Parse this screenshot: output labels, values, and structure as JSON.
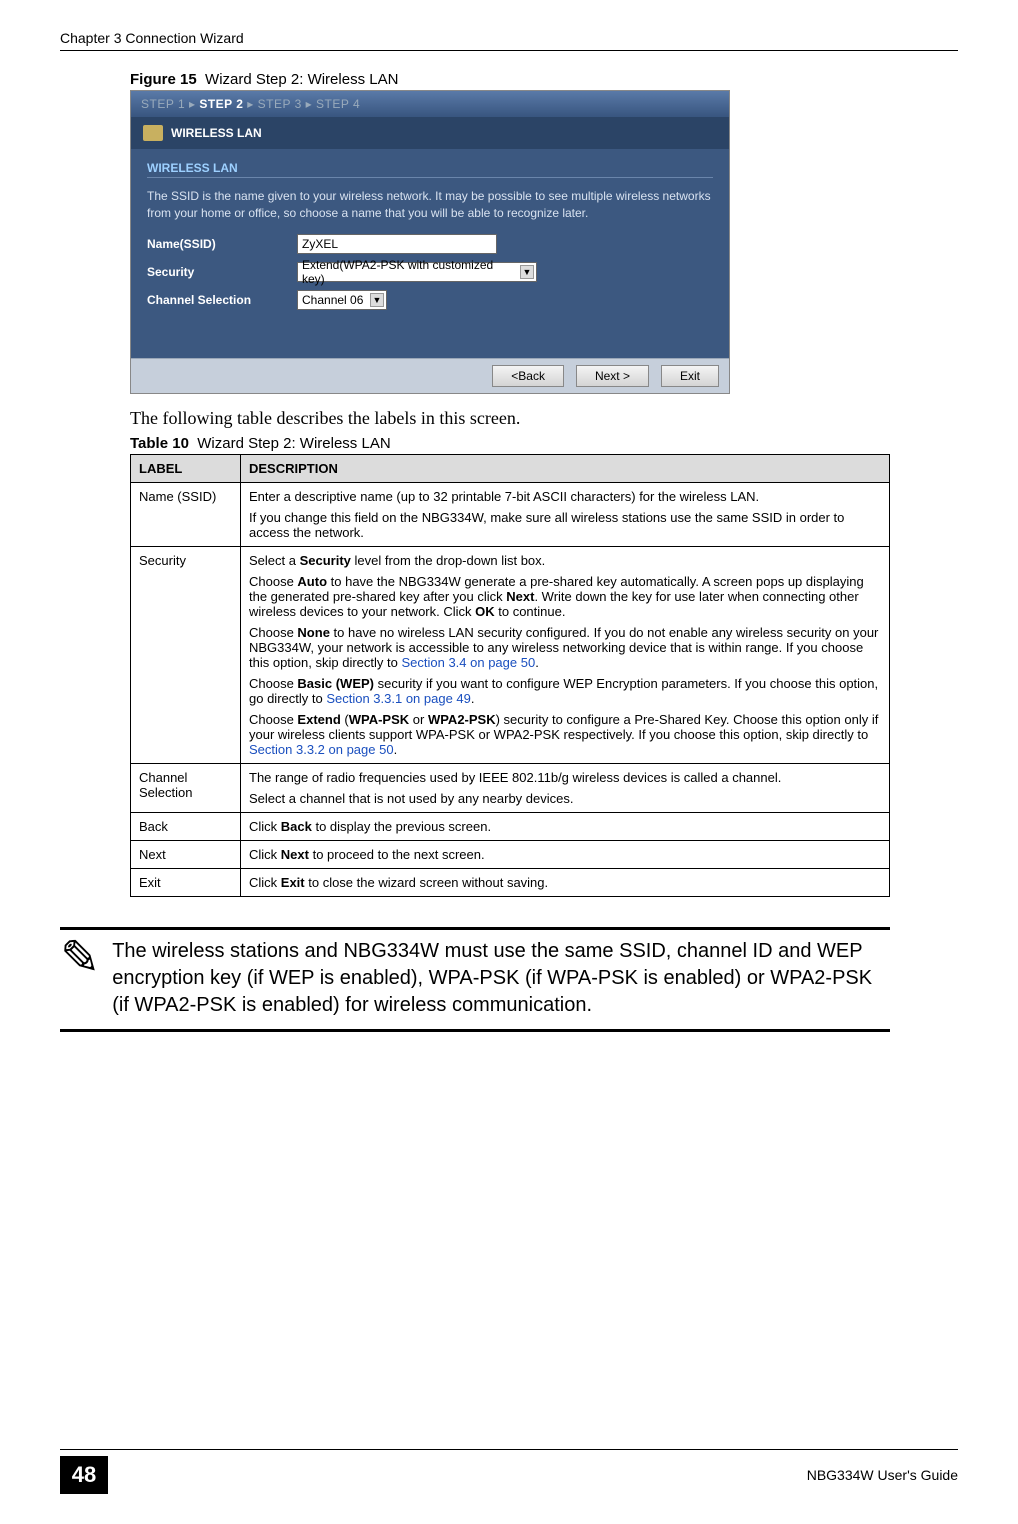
{
  "header": {
    "chapter": "Chapter 3 Connection Wizard"
  },
  "figure": {
    "label": "Figure 15",
    "title": "Wizard Step 2: Wireless LAN"
  },
  "wizard": {
    "steps_raw": "STEP 1 ▸ STEP 2 ▸ STEP 3 ▸ STEP 4",
    "step1": "STEP 1 ▸ ",
    "step2": "STEP 2",
    "step_rest": " ▸ STEP 3 ▸ STEP 4",
    "title": "WIRELESS LAN",
    "panel_label": "WIRELESS LAN",
    "desc": "The SSID is the name given to your wireless network. It may be possible to see multiple wireless networks from your home or office, so choose a name that you will be able to recognize later.",
    "fields": {
      "ssid_label": "Name(SSID)",
      "ssid_value": "ZyXEL",
      "security_label": "Security",
      "security_value": "Extend(WPA2-PSK with customized key)",
      "channel_label": "Channel Selection",
      "channel_value": "Channel 06"
    },
    "buttons": {
      "back": "<Back",
      "next": "Next >",
      "exit": "Exit"
    }
  },
  "body_text": "The following table describes the labels in this screen.",
  "table": {
    "label": "Table 10",
    "title": "Wizard Step 2: Wireless LAN",
    "head_label": "LABEL",
    "head_desc": "DESCRIPTION",
    "rows": {
      "r0": {
        "label": "Name (SSID)",
        "p1": "Enter a descriptive name (up to 32 printable 7-bit ASCII characters) for the wireless LAN.",
        "p2": "If you change this field on the NBG334W, make sure all wireless stations use the same SSID in order to access the network."
      },
      "r1": {
        "label": "Security",
        "p1a": "Select a ",
        "p1b": "Security",
        "p1c": " level from the drop-down list box.",
        "p2a": "Choose ",
        "p2b": "Auto",
        "p2c": " to have the NBG334W generate a pre-shared key automatically. A screen pops up displaying the generated pre-shared key after you click ",
        "p2d": "Next",
        "p2e": ". Write down the key for use later when connecting other wireless devices to your network. Click ",
        "p2f": "OK",
        "p2g": " to continue.",
        "p3a": "Choose ",
        "p3b": "None",
        "p3c": " to have no wireless LAN security configured. If you do not enable any wireless security on your NBG334W, your network is accessible to any wireless networking device that is within range. If you choose this option, skip directly to ",
        "p3link": "Section 3.4 on page 50",
        "p3d": ".",
        "p4a": "Choose ",
        "p4b": "Basic (WEP)",
        "p4c": " security if you want to configure WEP Encryption parameters. If you choose this option, go directly to ",
        "p4link": "Section 3.3.1 on page 49",
        "p4d": ".",
        "p5a": "Choose ",
        "p5b": "Extend",
        "p5c": " (",
        "p5d": "WPA-PSK",
        "p5e": " or ",
        "p5f": "WPA2-PSK",
        "p5g": ") security to configure a Pre-Shared Key. Choose this option only if your wireless clients support WPA-PSK or WPA2-PSK respectively. If you choose this option, skip directly to ",
        "p5link": "Section 3.3.2 on page 50",
        "p5h": "."
      },
      "r2": {
        "label": "Channel Selection",
        "p1": "The range of radio frequencies used by IEEE 802.11b/g wireless devices is called a channel.",
        "p2": "Select a channel that is not used by any nearby devices."
      },
      "r3": {
        "label": "Back",
        "p1a": "Click ",
        "p1b": "Back",
        "p1c": " to display the previous screen."
      },
      "r4": {
        "label": "Next",
        "p1a": "Click ",
        "p1b": "Next",
        "p1c": " to proceed to the next screen."
      },
      "r5": {
        "label": "Exit",
        "p1a": "Click ",
        "p1b": "Exit",
        "p1c": " to close the wizard screen without saving."
      }
    }
  },
  "note": {
    "icon": "✎",
    "text": "The wireless stations and NBG334W must use the same SSID, channel ID and WEP encryption key (if WEP is enabled), WPA-PSK (if WPA-PSK is enabled) or WPA2-PSK (if WPA2-PSK is enabled) for wireless communication."
  },
  "footer": {
    "page": "48",
    "guide": "NBG334W User's Guide"
  }
}
